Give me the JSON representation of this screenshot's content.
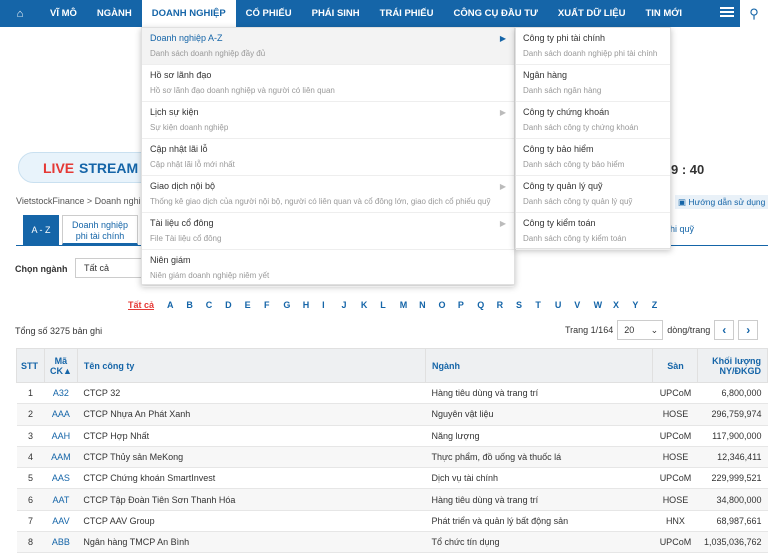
{
  "nav": {
    "items": [
      "VĨ MÔ",
      "NGÀNH",
      "DOANH NGHIỆP",
      "CỔ PHIẾU",
      "PHÁI SINH",
      "TRÁI PHIẾU",
      "CÔNG CỤ ĐẦU TƯ",
      "XUẤT DỮ LIỆU",
      "TIN MỚI"
    ],
    "active": "DOANH NGHIỆP"
  },
  "banner": {
    "live": "LIVE",
    "stream": "STREAM",
    "timer": "9 : 40"
  },
  "breadcrumb": "VietstockFinance >  Doanh nghi",
  "guide": "Hướng dẫn sử dụng",
  "tabs": {
    "az": "A - Z",
    "second_line1": "Doanh nghiệp",
    "second_line2": "phi tài chính",
    "right": "hi quỹ"
  },
  "filter": {
    "label": "Chọn ngành",
    "value": "Tất cả"
  },
  "letters": {
    "all": "Tất cả",
    "list": [
      "A",
      "B",
      "C",
      "D",
      "E",
      "F",
      "G",
      "H",
      "I",
      "J",
      "K",
      "L",
      "M",
      "N",
      "O",
      "P",
      "Q",
      "R",
      "S",
      "T",
      "U",
      "V",
      "W",
      "X",
      "Y",
      "Z"
    ]
  },
  "total": "Tổng số 3275 bản ghi",
  "pager": {
    "label": "Trang  1/164",
    "size": "20",
    "suffix": "dòng/trang",
    "prev": "‹",
    "next": "›"
  },
  "table": {
    "headers": {
      "stt": "STT",
      "code_l1": "Mã",
      "code_l2": "CK▲",
      "name": "Tên công ty",
      "industry": "Ngành",
      "exchange": "Sàn",
      "vol_l1": "Khối lượng",
      "vol_l2": "NY/ĐKGD"
    },
    "rows": [
      [
        "1",
        "A32",
        "CTCP 32",
        "Hàng tiêu dùng và trang trí",
        "UPCoM",
        "6,800,000"
      ],
      [
        "2",
        "AAA",
        "CTCP Nhựa An Phát Xanh",
        "Nguyên vật liệu",
        "HOSE",
        "296,759,974"
      ],
      [
        "3",
        "AAH",
        "CTCP Hợp Nhất",
        "Năng lượng",
        "UPCoM",
        "117,900,000"
      ],
      [
        "4",
        "AAM",
        "CTCP Thủy sản MeKong",
        "Thực phẩm, đồ uống và thuốc lá",
        "HOSE",
        "12,346,411"
      ],
      [
        "5",
        "AAS",
        "CTCP Chứng khoán SmartInvest",
        "Dịch vụ tài chính",
        "UPCoM",
        "229,999,521"
      ],
      [
        "6",
        "AAT",
        "CTCP Tập Đoàn Tiên Sơn Thanh Hóa",
        "Hàng tiêu dùng và trang trí",
        "HOSE",
        "34,800,000"
      ],
      [
        "7",
        "AAV",
        "CTCP AAV Group",
        "Phát triển và quản lý bất động sản",
        "HNX",
        "68,987,661"
      ],
      [
        "8",
        "ABB",
        "Ngân hàng TMCP An Bình",
        "Tổ chức tín dụng",
        "UPCoM",
        "1,035,036,762"
      ]
    ]
  },
  "dropdown": [
    {
      "t": "Doanh nghiệp A-Z",
      "s": "Danh sách doanh nghiệp đầy đủ",
      "arrow": true
    },
    {
      "t": "Hồ sơ lãnh đạo",
      "s": "Hồ sơ lãnh đạo doanh nghiệp và người có liên quan",
      "arrow": false
    },
    {
      "t": "Lịch sự kiện",
      "s": "Sự kiện doanh nghiệp",
      "arrow": true
    },
    {
      "t": "Cập nhật lãi lỗ",
      "s": "Cập nhật lãi lỗ mới nhất",
      "arrow": false
    },
    {
      "t": "Giao dịch nội bộ",
      "s": "Thống kê giao dịch của người nội bộ, người có liên quan và cổ đông lớn, giao dịch cổ phiếu quỹ",
      "arrow": true
    },
    {
      "t": "Tài liệu cổ đông",
      "s": "File Tài liệu cổ đông",
      "arrow": true
    },
    {
      "t": "Niên giám",
      "s": "Niên giám doanh nghiệp niêm yết",
      "arrow": false
    }
  ],
  "submenu": [
    {
      "t": "Công ty phi tài chính",
      "s": "Danh sách doanh nghiệp phi tài chính"
    },
    {
      "t": "Ngân hàng",
      "s": "Danh sách ngân hàng"
    },
    {
      "t": "Công ty chứng khoán",
      "s": "Danh sách công ty chứng khoán"
    },
    {
      "t": "Công ty bảo hiểm",
      "s": "Danh sách công ty bảo hiểm"
    },
    {
      "t": "Công ty quản lý quỹ",
      "s": "Danh sách công ty quản lý quỹ"
    },
    {
      "t": "Công ty kiểm toán",
      "s": "Danh sách công ty kiểm toán"
    }
  ]
}
